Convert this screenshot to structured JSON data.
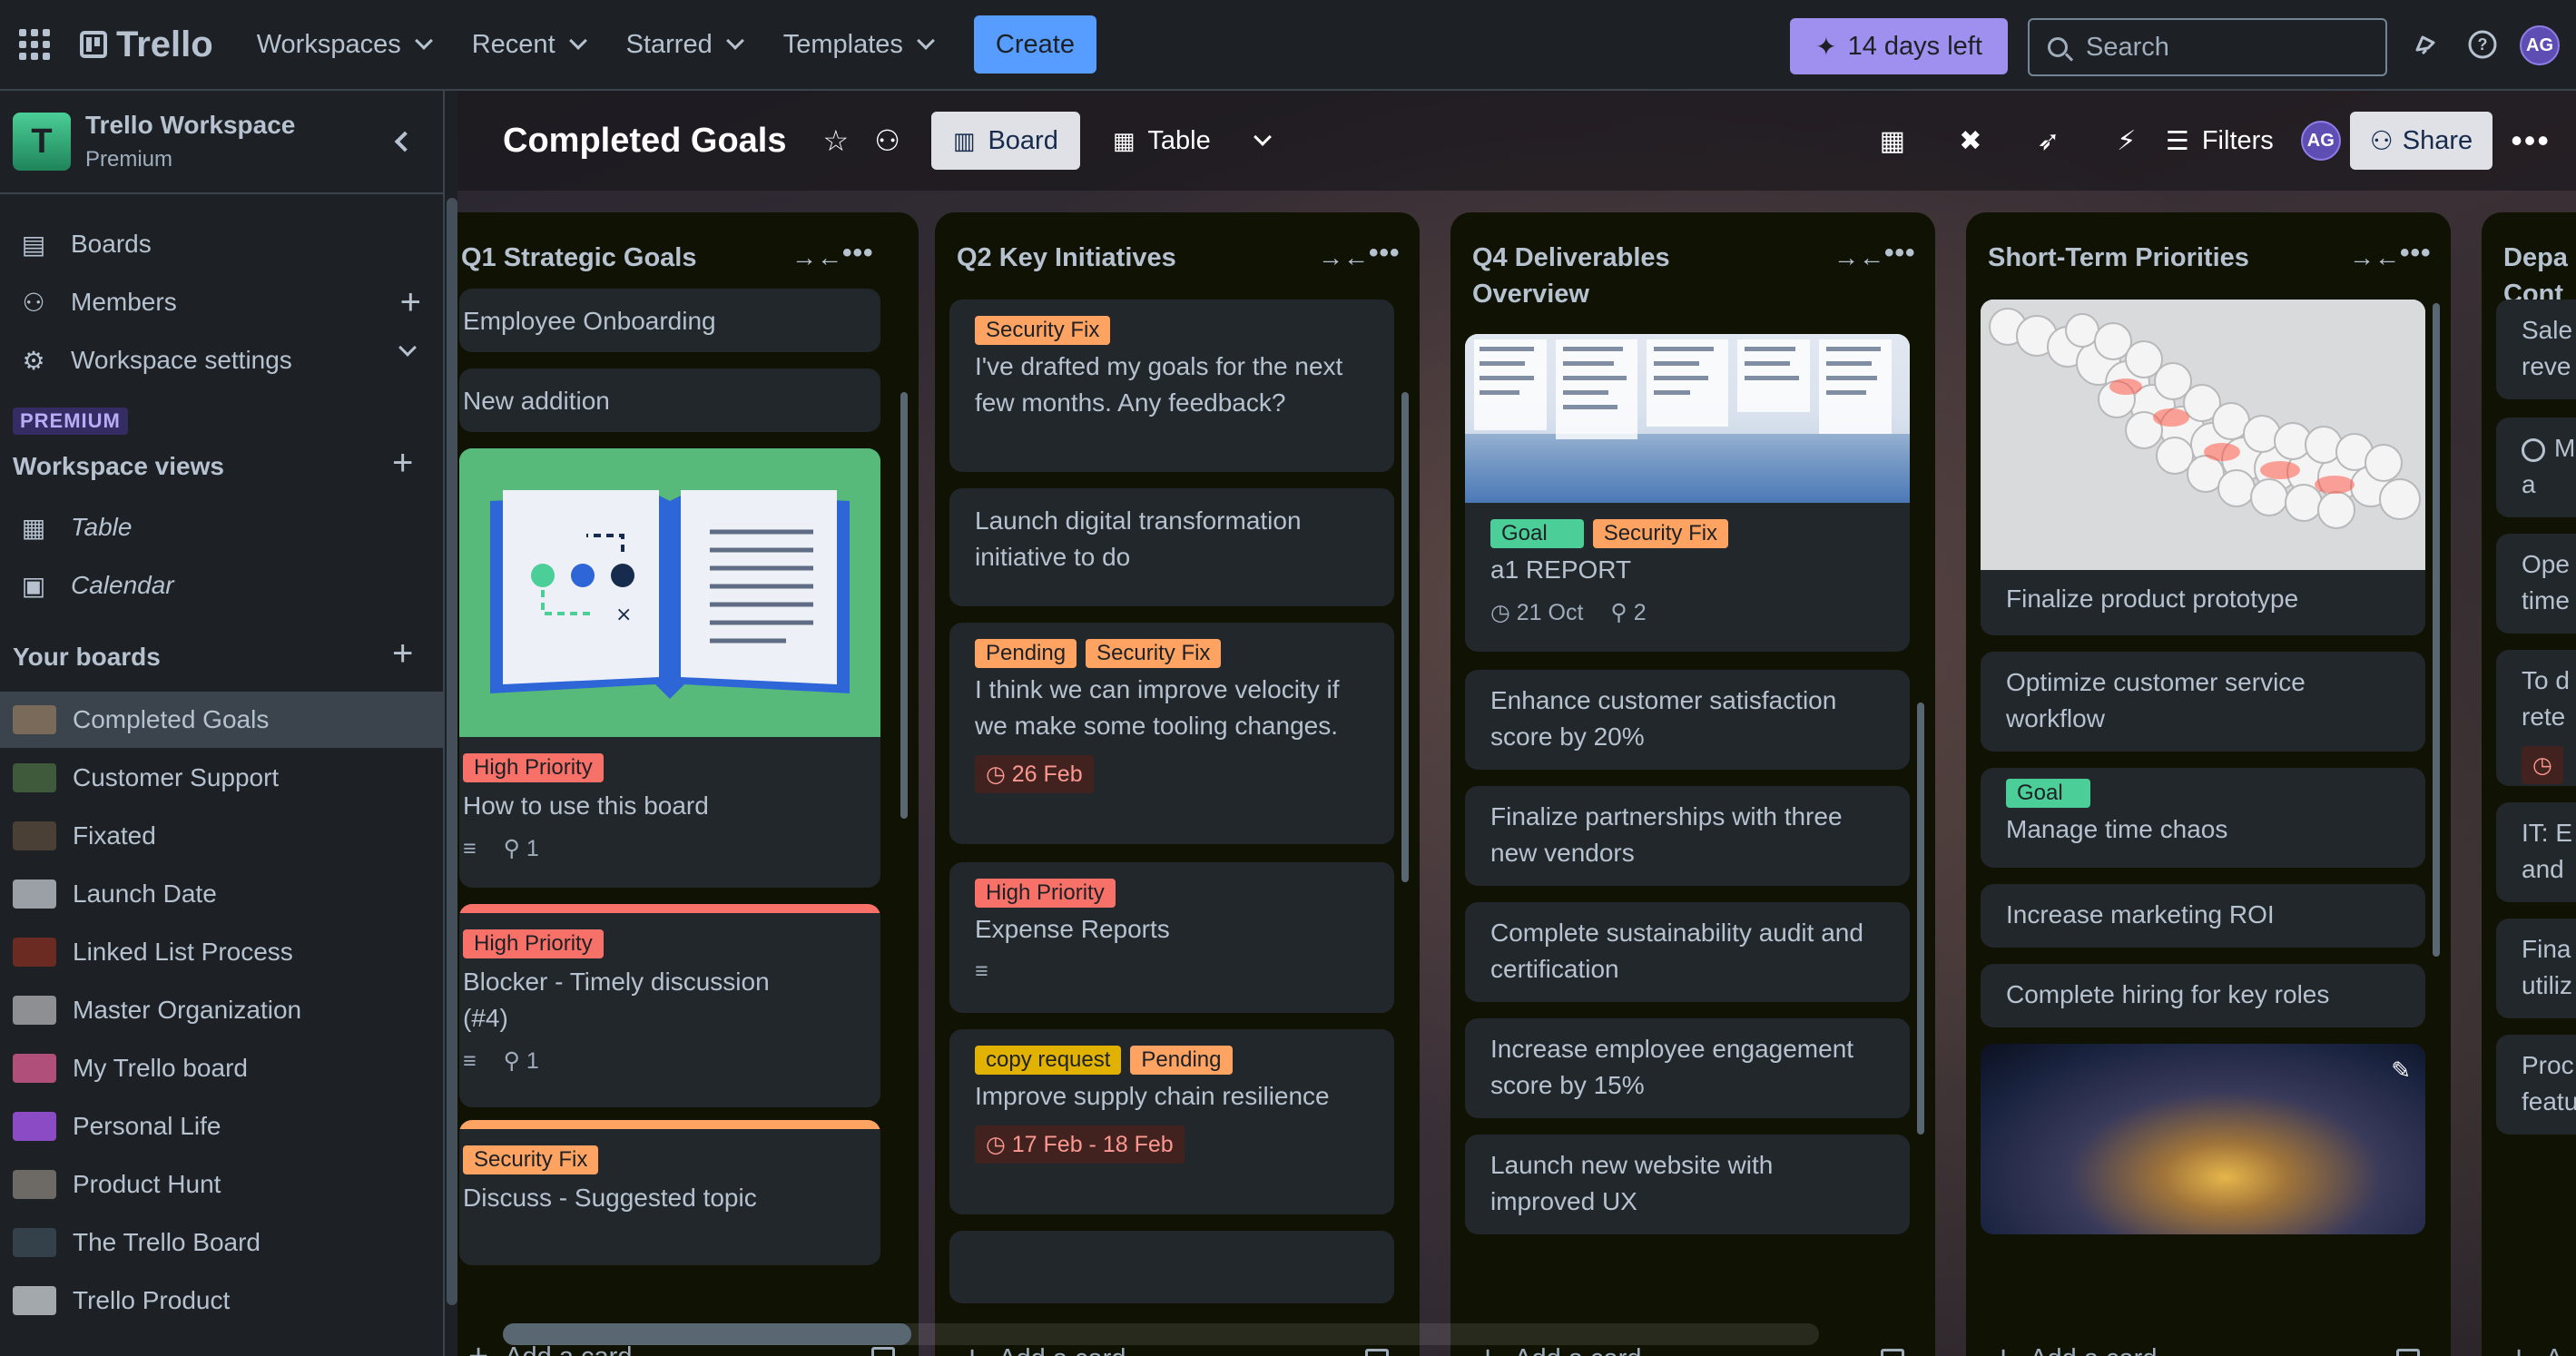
{
  "nav": {
    "brand": "Trello",
    "menus": [
      "Workspaces",
      "Recent",
      "Starred",
      "Templates"
    ],
    "create": "Create",
    "trial": "14 days left",
    "search_placeholder": "Search",
    "avatar_initials": "AG",
    "icons": [
      "apps-grid-icon",
      "bell-icon",
      "help-icon"
    ]
  },
  "sidebar": {
    "workspace_name": "Trello Workspace",
    "workspace_plan": "Premium",
    "workspace_initial": "T",
    "items": [
      {
        "label": "Boards",
        "icon": "boards-icon"
      },
      {
        "label": "Members",
        "icon": "person-icon"
      },
      {
        "label": "Workspace settings",
        "icon": "gear-icon"
      }
    ],
    "premium_tag": "PREMIUM",
    "views_heading": "Workspace views",
    "views": [
      {
        "label": "Table",
        "icon": "table-icon"
      },
      {
        "label": "Calendar",
        "icon": "calendar-icon"
      }
    ],
    "boards_heading": "Your boards",
    "boards": [
      {
        "label": "Completed Goals",
        "color": "#7a6a5a",
        "active": true
      },
      {
        "label": "Customer Support",
        "color": "#3f5a3a"
      },
      {
        "label": "Fixated",
        "color": "#4a4035"
      },
      {
        "label": "Launch Date",
        "color": "#9aa0a6"
      },
      {
        "label": "Linked List Process",
        "color": "#6b2a22"
      },
      {
        "label": "Master Organization",
        "color": "#8d8f93"
      },
      {
        "label": "My Trello board",
        "color": "#b0507a"
      },
      {
        "label": "Personal Life",
        "color": "#8a4bc4"
      },
      {
        "label": "Product Hunt",
        "color": "#6d6a66"
      },
      {
        "label": "The Trello Board",
        "color": "#34404a"
      },
      {
        "label": "Trello Product",
        "color": "#a3a8ad"
      }
    ]
  },
  "board": {
    "title": "Completed Goals",
    "views": [
      {
        "label": "Board",
        "active": true
      },
      {
        "label": "Table",
        "active": false
      }
    ],
    "filters": "Filters",
    "share": "Share",
    "avatar_initials": "AG"
  },
  "lists": [
    {
      "title": "Q1 Strategic Goals",
      "add_card": "Add a card",
      "cards": [
        {
          "text": "Employee Onboarding",
          "labels": []
        },
        {
          "text": "New addition",
          "labels": []
        },
        {
          "text": "How to use this board",
          "labels": [
            {
              "text": "High Priority",
              "color": "red"
            }
          ],
          "cover": "book-illustration",
          "badges": {
            "description": true,
            "attachments": "1"
          }
        },
        {
          "text": "Blocker - Timely discussion (#4)",
          "labels": [
            {
              "text": "High Priority",
              "color": "red"
            }
          ],
          "cover_color": "#f87168",
          "badges": {
            "description": true,
            "attachments": "1"
          }
        },
        {
          "text": "Discuss - Suggested topic",
          "labels": [
            {
              "text": "Security Fix",
              "color": "orange"
            }
          ],
          "cover_color": "#fea362"
        }
      ]
    },
    {
      "title": "Q2 Key Initiatives",
      "add_card": "Add a card",
      "cards": [
        {
          "text": "I've drafted my goals for the next few months. Any feedback?",
          "labels": [
            {
              "text": "Security Fix",
              "color": "orange"
            }
          ]
        },
        {
          "text": "Launch digital transformation initiative to do",
          "labels": []
        },
        {
          "text": "I think we can improve velocity if we make some tooling changes.",
          "labels": [
            {
              "text": "Pending",
              "color": "orange"
            },
            {
              "text": "Security Fix",
              "color": "orange"
            }
          ],
          "due": "26 Feb"
        },
        {
          "text": "Expense Reports",
          "labels": [
            {
              "text": "High Priority",
              "color": "red"
            }
          ],
          "badges": {
            "description": true
          }
        },
        {
          "text": "Improve supply chain resilience",
          "labels": [
            {
              "text": "copy request",
              "color": "yellow"
            },
            {
              "text": "Pending",
              "color": "orange"
            }
          ],
          "due": "17 Feb - 18 Feb"
        }
      ]
    },
    {
      "title": "Q4 Deliverables Overview",
      "add_card": "Add a card",
      "cards": [
        {
          "text": "a1 REPORT",
          "labels": [
            {
              "text": "Goal",
              "color": "green"
            },
            {
              "text": "Security Fix",
              "color": "orange"
            }
          ],
          "cover": "screenshot",
          "date": "21 Oct",
          "attachments": "2"
        },
        {
          "text": "Enhance customer satisfaction score by 20%",
          "labels": []
        },
        {
          "text": "Finalize partnerships with three new vendors",
          "labels": []
        },
        {
          "text": "Complete sustainability audit and certification",
          "labels": []
        },
        {
          "text": "Increase employee engagement score by 15%",
          "labels": []
        },
        {
          "text": "Launch new website with improved UX",
          "labels": []
        }
      ]
    },
    {
      "title": "Short-Term Priorities",
      "add_card": "Add a card",
      "cards": [
        {
          "text": "Finalize product prototype",
          "labels": [],
          "cover": "spheres"
        },
        {
          "text": "Optimize customer service workflow",
          "labels": []
        },
        {
          "text": "Manage time chaos",
          "labels": [
            {
              "text": "Goal",
              "color": "green"
            }
          ]
        },
        {
          "text": "Increase marketing ROI",
          "labels": []
        },
        {
          "text": "Complete hiring for key roles",
          "labels": []
        },
        {
          "text": "",
          "labels": [],
          "cover": "nebula"
        }
      ]
    },
    {
      "title": "Depa Cont",
      "cards_partial": [
        "Sale reve",
        "M a",
        "Ope time",
        "To d rete",
        "IT: E and",
        "Fina utiliz",
        "Proc featu"
      ],
      "add_card": "A"
    }
  ]
}
